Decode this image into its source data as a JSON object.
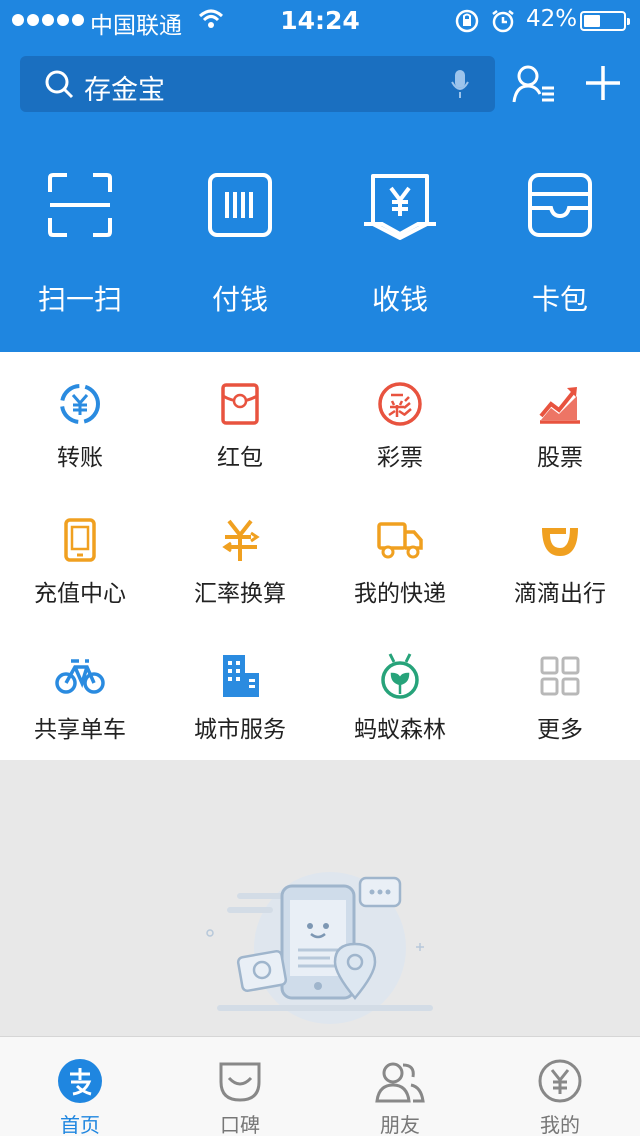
{
  "status_bar": {
    "carrier": "中国联通",
    "time": "14:24",
    "battery": "42%",
    "battery_level": 0.42
  },
  "search": {
    "placeholder": "存金宝"
  },
  "big_actions": [
    {
      "label": "扫一扫",
      "icon": "scan-icon"
    },
    {
      "label": "付钱",
      "icon": "barcode-icon"
    },
    {
      "label": "收钱",
      "icon": "receive-money-icon"
    },
    {
      "label": "卡包",
      "icon": "card-wallet-icon"
    }
  ],
  "grid": [
    {
      "label": "转账",
      "icon": "transfer-icon",
      "color": "#2a8be0"
    },
    {
      "label": "红包",
      "icon": "red-envelope-icon",
      "color": "#e8533f"
    },
    {
      "label": "彩票",
      "icon": "lottery-icon",
      "color": "#e8533f"
    },
    {
      "label": "股票",
      "icon": "stock-icon",
      "color": "#e8533f"
    },
    {
      "label": "充值中心",
      "icon": "phone-recharge-icon",
      "color": "#f0a020"
    },
    {
      "label": "汇率换算",
      "icon": "exchange-rate-icon",
      "color": "#f0a020"
    },
    {
      "label": "我的快递",
      "icon": "delivery-truck-icon",
      "color": "#f0a020"
    },
    {
      "label": "滴滴出行",
      "icon": "didi-icon",
      "color": "#f0a020"
    },
    {
      "label": "共享单车",
      "icon": "bicycle-icon",
      "color": "#2a8be0"
    },
    {
      "label": "城市服务",
      "icon": "city-building-icon",
      "color": "#2a8be0"
    },
    {
      "label": "蚂蚁森林",
      "icon": "ant-forest-icon",
      "color": "#27a37a"
    },
    {
      "label": "更多",
      "icon": "more-grid-icon",
      "color": "#b8b8b8"
    }
  ],
  "tabs": [
    {
      "label": "首页",
      "icon": "alipay-home-icon",
      "active": true
    },
    {
      "label": "口碑",
      "icon": "koubei-icon",
      "active": false
    },
    {
      "label": "朋友",
      "icon": "friends-icon",
      "active": false
    },
    {
      "label": "我的",
      "icon": "my-yuan-icon",
      "active": false
    }
  ],
  "colors": {
    "brand_blue": "#1f86e0",
    "search_bg": "#1a6fc0",
    "orange": "#f0a020",
    "red": "#e8533f",
    "green": "#27a37a"
  }
}
